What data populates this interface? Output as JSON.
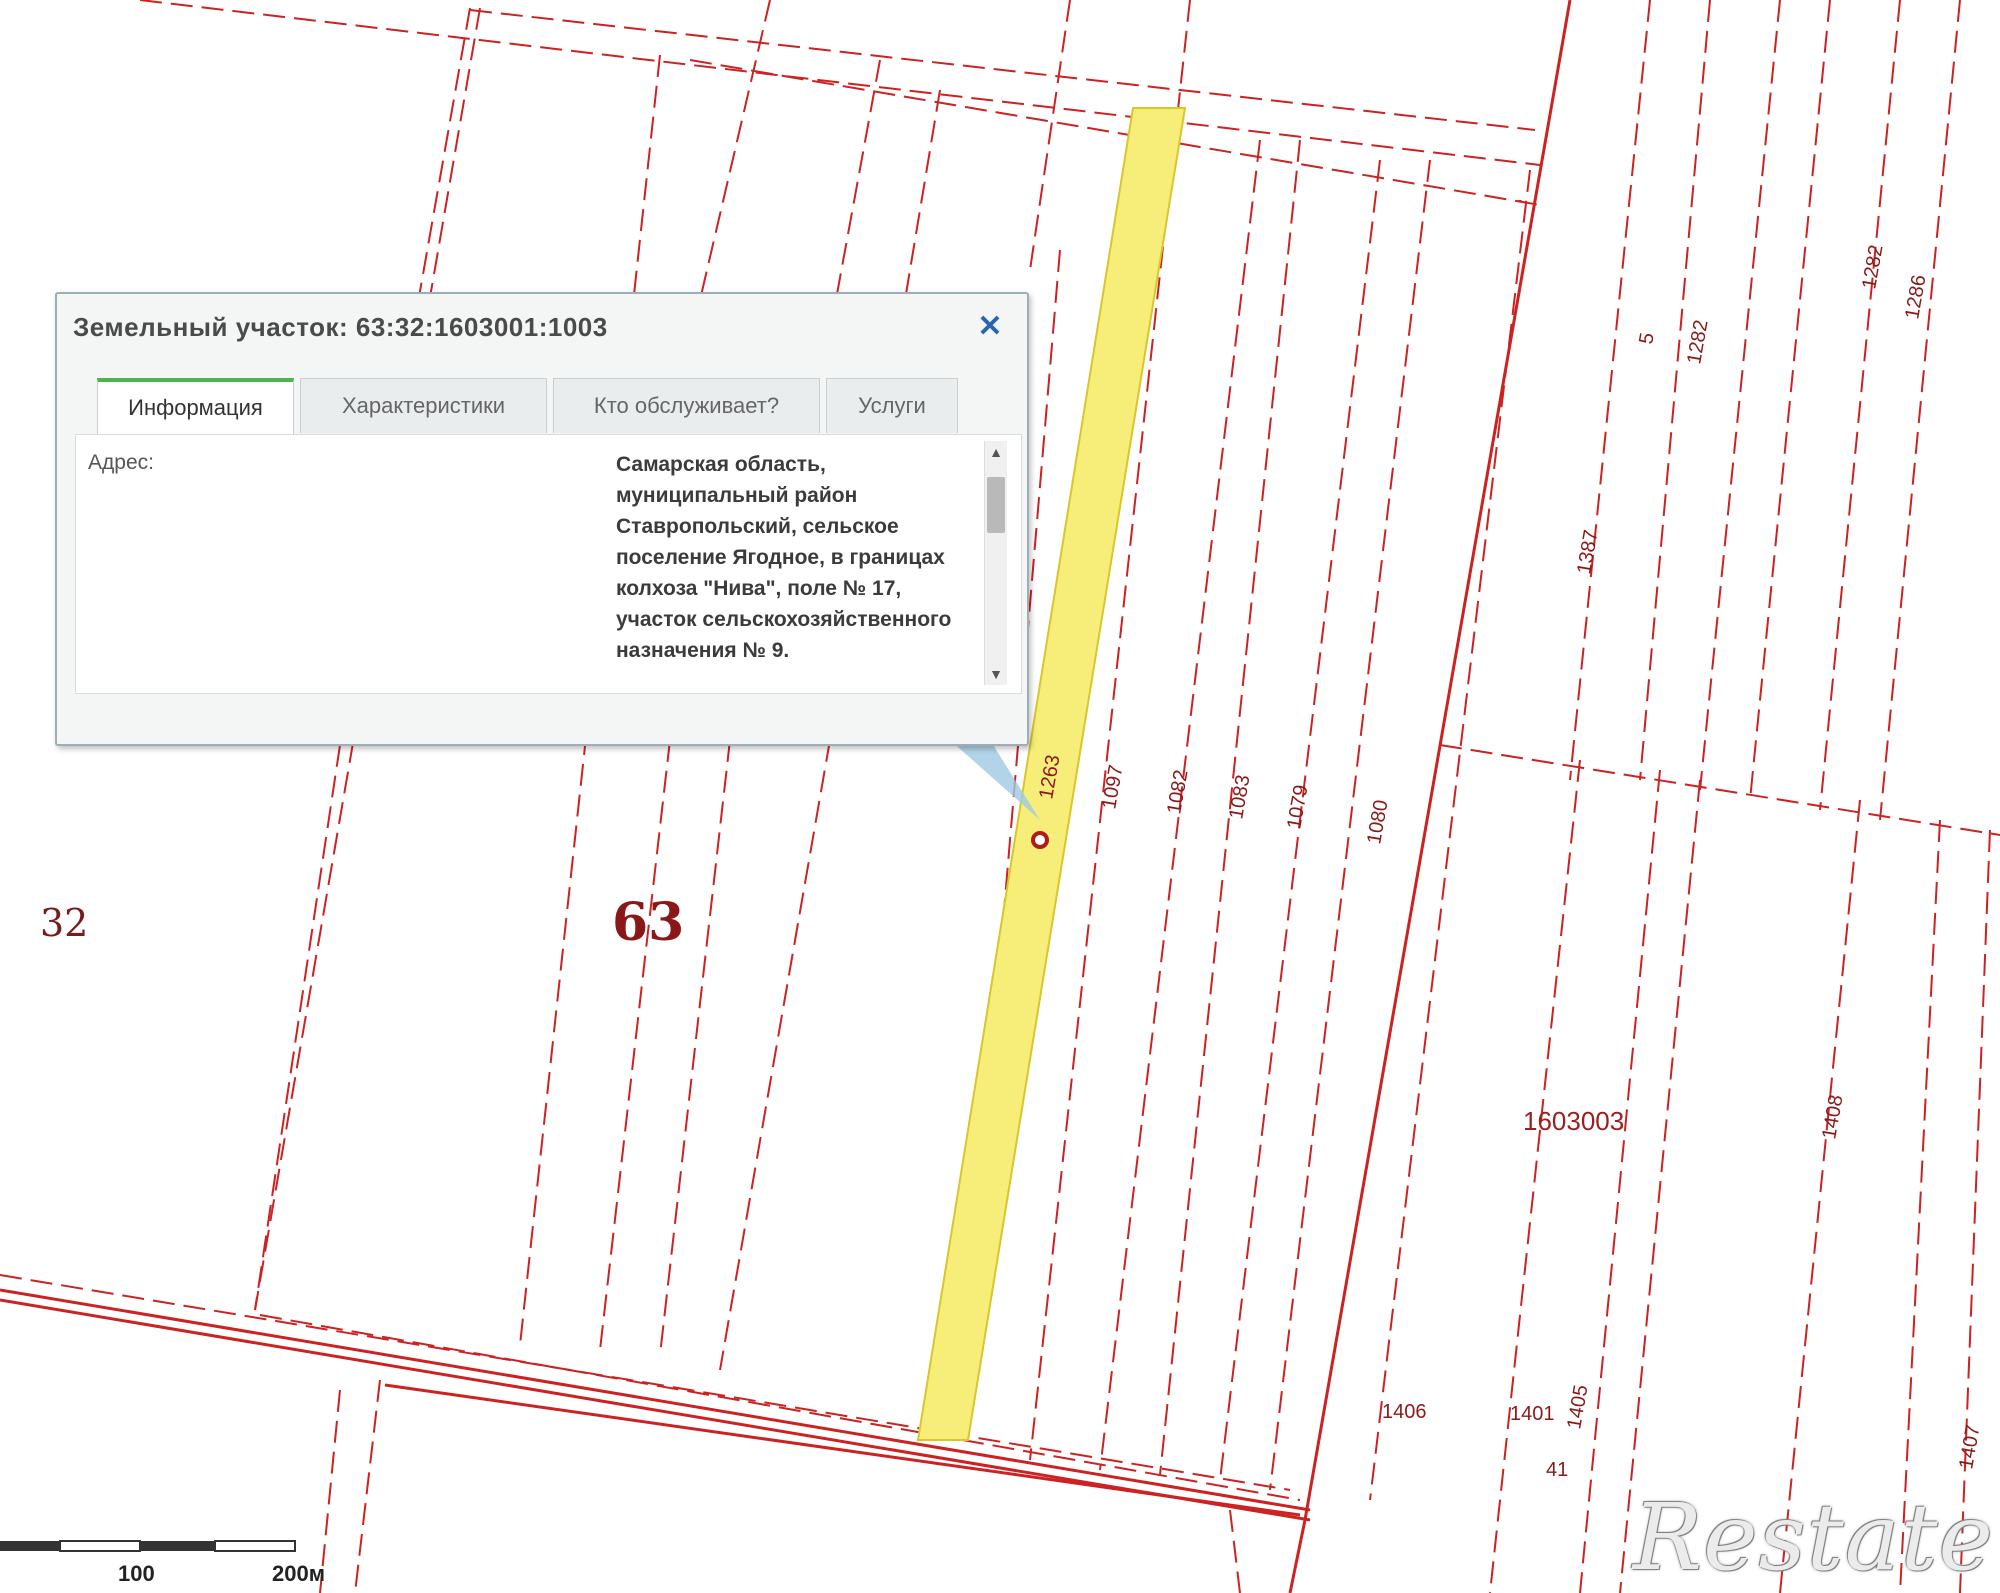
{
  "map": {
    "quarter_labels": [
      {
        "text": "32"
      },
      {
        "text": "63"
      }
    ],
    "block_label": "1603003",
    "parcel_labels": [
      "1263",
      "1097",
      "1082",
      "1083",
      "1079",
      "1080",
      "1387",
      "5",
      "1282",
      "1282",
      "1286",
      "1406",
      "1408",
      "1401",
      "1405",
      "41",
      "1407"
    ],
    "colors": {
      "boundary": "#cc2222",
      "selected_parcel": "#f6ee78",
      "marker": "#b01c1c"
    }
  },
  "popup": {
    "title": "Земельный участок: 63:32:1603001:1003",
    "close_icon": "close-icon",
    "tabs": [
      {
        "label": "Информация",
        "active": true
      },
      {
        "label": "Характеристики",
        "active": false
      },
      {
        "label": "Кто обслуживает?",
        "active": false
      },
      {
        "label": "Услуги",
        "active": false
      }
    ],
    "field_label": "Адрес:",
    "field_value": "Самарская область, муниципальный район Ставропольский, сельское поселение Ягодное, в границах колхоза \"Нива\", поле № 17, участок сельскохозяйственного назначения № 9."
  },
  "scale_bar": {
    "labels": [
      "100",
      "200м"
    ]
  },
  "watermark": "Restate"
}
